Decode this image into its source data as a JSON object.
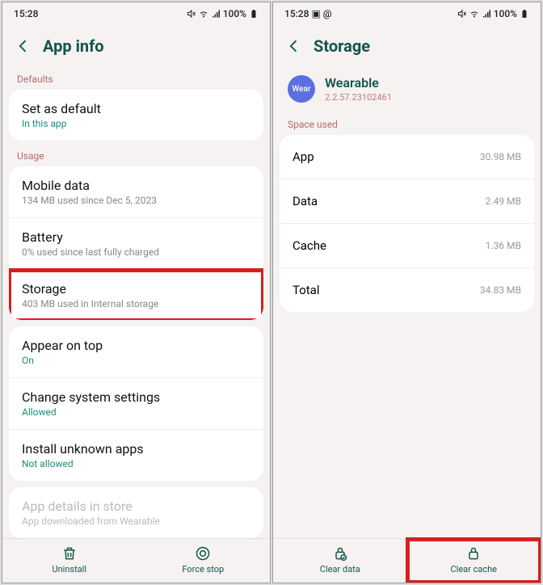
{
  "left": {
    "time": "15:28",
    "battery": "100%",
    "title": "App info",
    "sections": {
      "defaults": "Defaults",
      "usage": "Usage"
    },
    "defaultCard": {
      "title": "Set as default",
      "sub": "In this app"
    },
    "usageRows": [
      {
        "title": "Mobile data",
        "sub": "134 MB used since Dec 5, 2023"
      },
      {
        "title": "Battery",
        "sub": "0% used since last fully charged"
      },
      {
        "title": "Storage",
        "sub": "403 MB used in Internal storage"
      }
    ],
    "otherRows": [
      {
        "title": "Appear on top",
        "sub": "On"
      },
      {
        "title": "Change system settings",
        "sub": "Allowed"
      },
      {
        "title": "Install unknown apps",
        "sub": "Not allowed"
      }
    ],
    "storeRow": {
      "title": "App details in store",
      "sub": "App downloaded from Wearable"
    },
    "bottom": {
      "uninstall": "Uninstall",
      "forceStop": "Force stop"
    }
  },
  "right": {
    "time": "15:28",
    "battery": "100%",
    "title": "Storage",
    "app": {
      "icon": "Wear",
      "name": "Wearable",
      "version": "2.2.57.23102461"
    },
    "spaceUsed": "Space used",
    "rows": [
      {
        "label": "App",
        "value": "30.98 MB"
      },
      {
        "label": "Data",
        "value": "2.49 MB"
      },
      {
        "label": "Cache",
        "value": "1.36 MB"
      },
      {
        "label": "Total",
        "value": "34.83 MB"
      }
    ],
    "bottom": {
      "clearData": "Clear data",
      "clearCache": "Clear cache"
    }
  }
}
